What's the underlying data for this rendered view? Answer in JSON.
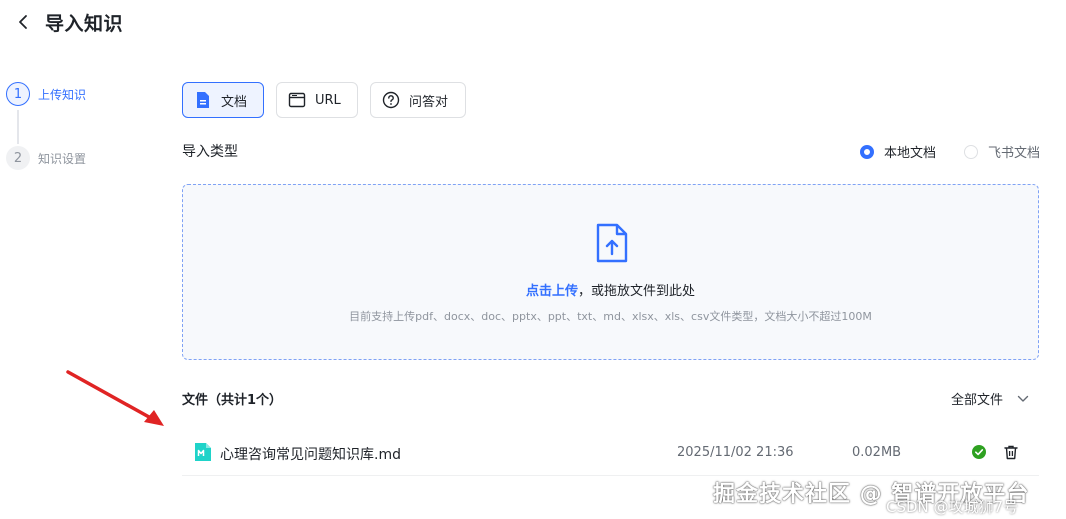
{
  "header": {
    "title": "导入知识"
  },
  "steps": [
    {
      "number": "1",
      "label": "上传知识",
      "state": "active"
    },
    {
      "number": "2",
      "label": "知识设置",
      "state": "inactive"
    }
  ],
  "tabs": [
    {
      "label": "文档",
      "icon": "document-icon",
      "active": true
    },
    {
      "label": "URL",
      "icon": "browser-window-icon",
      "active": false
    },
    {
      "label": "问答对",
      "icon": "question-circle-icon",
      "active": false
    }
  ],
  "import_type": {
    "label": "导入类型",
    "options": [
      {
        "label": "本地文档",
        "checked": true
      },
      {
        "label": "飞书文档",
        "checked": false
      }
    ]
  },
  "dropzone": {
    "link_text": "点击上传",
    "text_rest": "，或拖放文件到此处",
    "hint": "目前支持上传pdf、docx、doc、pptx、ppt、txt、md、xlsx、xls、csv文件类型，文档大小不超过100M"
  },
  "files": {
    "title": "文件（共计1个）",
    "filter_label": "全部文件",
    "items": [
      {
        "name": "心理咨询常见问题知识库.md",
        "date": "2025/11/02 21:36",
        "size": "0.02MB",
        "status": "success"
      }
    ]
  },
  "watermark": {
    "text": "掘金技术社区 @ 智谱开放平台",
    "sub": "CSDN @攻城狮7号"
  },
  "colors": {
    "accent": "#3370ff",
    "success": "#2ea121",
    "annotation_arrow": "#e02424"
  }
}
